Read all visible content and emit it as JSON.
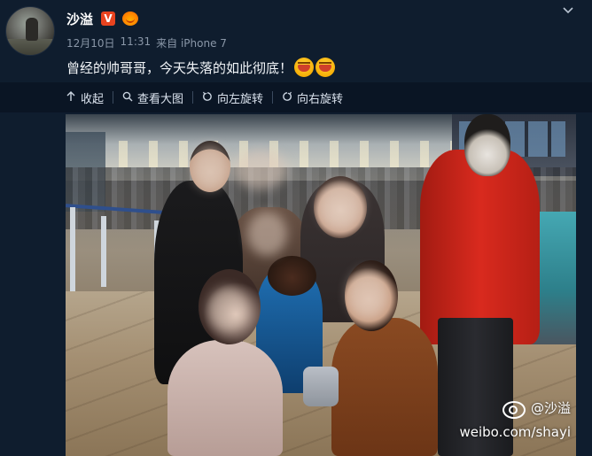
{
  "post": {
    "username": "沙溢",
    "vip_badge": "V",
    "crown_badge_icon": "crown-badge-icon",
    "meta": {
      "date": "12月10日",
      "time": "11:31",
      "source": "来自 iPhone 7"
    },
    "text": "曾经的帅哥哥，今天失落的如此彻底！",
    "emojis": [
      "laughing-emoji",
      "laughing-emoji"
    ]
  },
  "toolbar": {
    "collapse_label": "收起",
    "view_large_label": "查看大图",
    "rotate_left_label": "向左旋转",
    "rotate_right_label": "向右旋转"
  },
  "photo": {
    "watermark_handle": "@沙溢",
    "watermark_url": "weibo.com/shayi"
  },
  "colors": {
    "background": "#0f1d2e",
    "toolbar_bg": "#0a1524",
    "text_primary": "#f2f5f8",
    "text_muted": "#8a97a8",
    "vip_red": "#e8431f"
  }
}
